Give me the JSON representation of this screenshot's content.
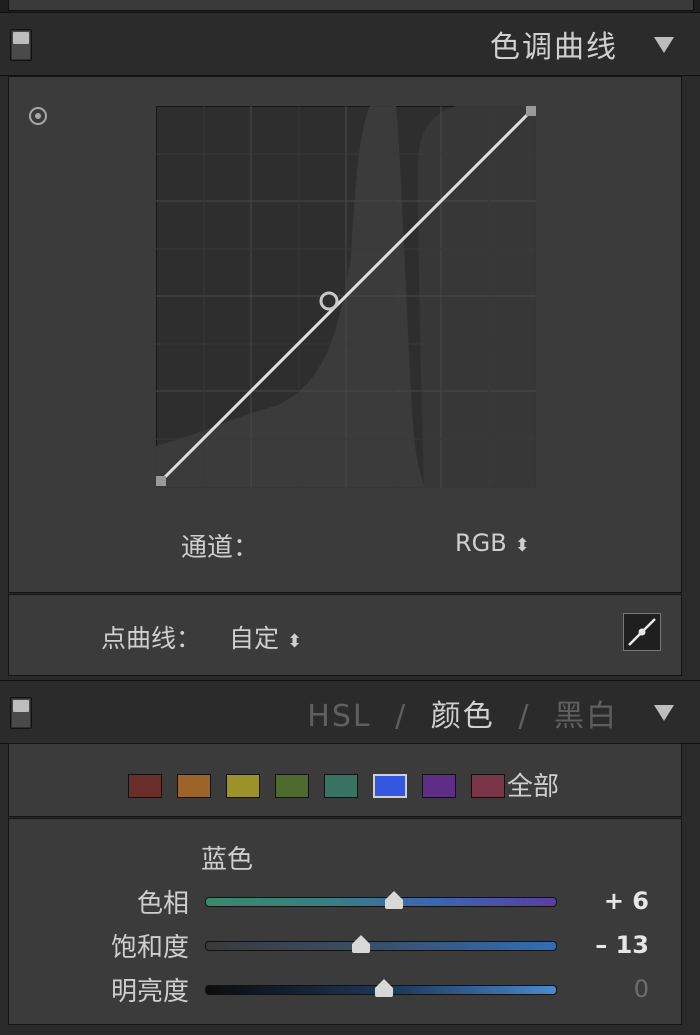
{
  "tone_curve": {
    "title": "色调曲线",
    "channel_label": "通道：",
    "channel_value": "RGB",
    "point_curve_label": "点曲线：",
    "point_curve_value": "自定"
  },
  "hsl": {
    "tabs": [
      "HSL",
      "/",
      "颜色",
      "/",
      "黑白"
    ],
    "active_tab": "颜色",
    "swatches": [
      {
        "name": "red",
        "color": "#6a2e2a"
      },
      {
        "name": "orange",
        "color": "#9c6428"
      },
      {
        "name": "yellow",
        "color": "#9c922a"
      },
      {
        "name": "green",
        "color": "#4e6a2e"
      },
      {
        "name": "aqua",
        "color": "#3a7262"
      },
      {
        "name": "blue",
        "color": "#3556e0"
      },
      {
        "name": "purple",
        "color": "#5e2e86"
      },
      {
        "name": "magenta",
        "color": "#7a3648"
      }
    ],
    "selected_swatch": "blue",
    "all_label": "全部",
    "section_label": "蓝色",
    "sliders": [
      {
        "label": "色相",
        "value": "+ 6",
        "position": 0.53
      },
      {
        "label": "饱和度",
        "value": "– 13",
        "position": 0.44
      },
      {
        "label": "明亮度",
        "value": "0",
        "position": 0.5
      }
    ]
  },
  "icons": [
    "panel-switch-icon",
    "collapse-triangle-icon",
    "target-adjust-icon",
    "point-curve-icon"
  ]
}
